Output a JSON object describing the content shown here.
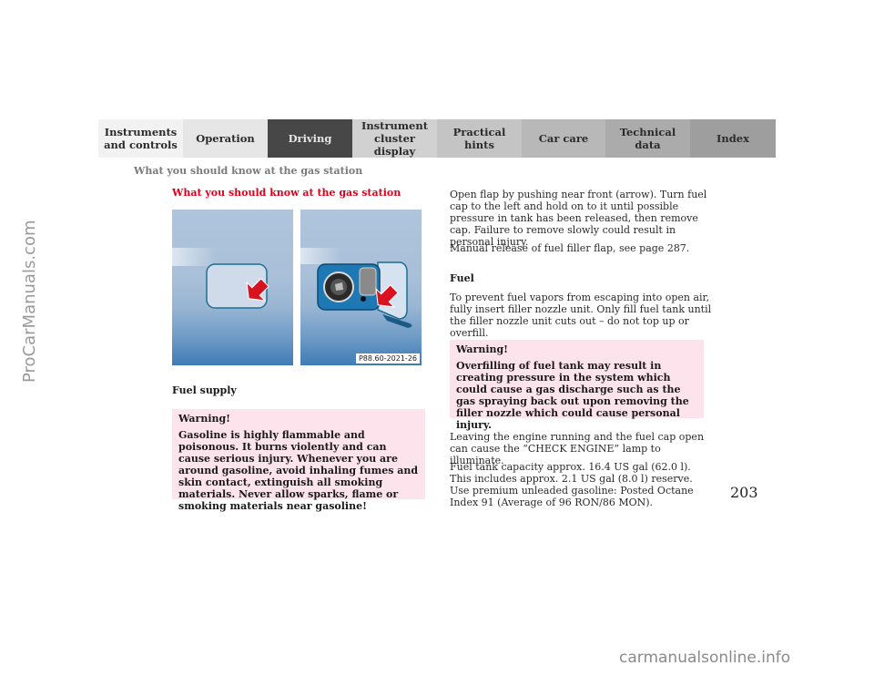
{
  "nav_tabs": [
    {
      "label": "Instruments\nand controls",
      "active": false
    },
    {
      "label": "Operation",
      "active": false
    },
    {
      "label": "Driving",
      "active": true
    },
    {
      "label": "Instrument\ncluster display",
      "active": false
    },
    {
      "label": "Practical hints",
      "active": false
    },
    {
      "label": "Car care",
      "active": false
    },
    {
      "label": "Technical\ndata",
      "active": false
    },
    {
      "label": "Index",
      "active": false
    }
  ],
  "running_head": "What you should know at the gas station",
  "section_title": "What you should know at the gas station",
  "figure": {
    "code": "P88.60-2021-26",
    "caption": "Fuel supply",
    "left_panel": "fuel-flap-closed",
    "right_panel": "fuel-flap-open-cap"
  },
  "warning_left": {
    "title": "Warning!",
    "body": "Gasoline is highly flammable and poisonous. It burns violently and can cause serious injury. Whenever you are around gasoline, avoid inhaling fumes and skin contact, extinguish all smoking materials. Never allow sparks, flame or smoking materials near gasoline!"
  },
  "right_column": {
    "p1": "Open flap by pushing near front (arrow). Turn fuel cap to the left and hold on to it until possible pressure in tank has been released, then remove cap. Failure to remove slowly could result in personal injury.",
    "p2": "Manual release of fuel filler flap, see page 287.",
    "fuel_heading": "Fuel",
    "p3": "To prevent fuel vapors from escaping into open air, fully insert filler nozzle unit. Only fill fuel tank until the filler nozzle unit cuts out – do not top up or overfill.",
    "warning": {
      "title": "Warning!",
      "body": "Overfilling of fuel tank may result in creating pressure in the system which could cause a gas discharge such as the gas spraying back out upon removing the filler nozzle which could cause personal injury."
    },
    "p4": "Leaving the engine running and the fuel cap open can cause the “CHECK ENGINE” lamp to illuminate.",
    "p5_line1": "Fuel tank capacity approx. 16.4 US gal (62.0 l).",
    "p5_rest": "This includes approx. 2.1 US gal (8.0 l) reserve. Use premium unleaded gasoline: Posted Octane Index 91 (Average of 96 RON/86 MON)."
  },
  "page_number": "203",
  "watermarks": {
    "side": "ProCarManuals.com",
    "bottom": "carmanualsonline.info"
  },
  "colors": {
    "section_title": "#e0001b",
    "warning_bg": "#fde4ec",
    "active_tab": "#474747",
    "arrow_red": "#d9121f"
  }
}
